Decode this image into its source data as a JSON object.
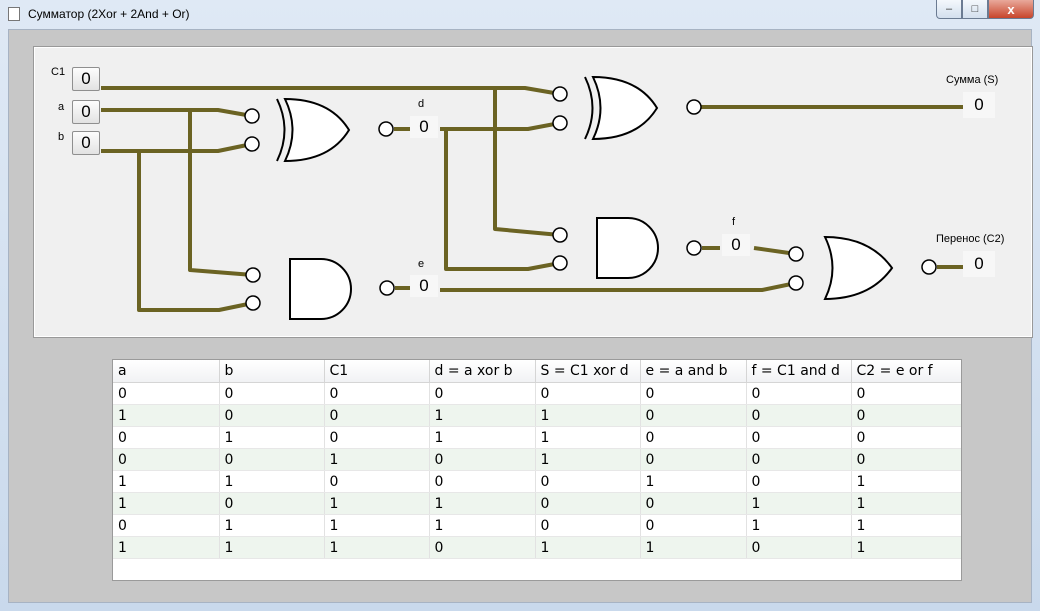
{
  "window": {
    "title": "Сумматор (2Xor + 2And + Or)",
    "controls": {
      "minimize": "–",
      "maximize": "□",
      "close": "x"
    }
  },
  "circuit": {
    "wire_color": "#6b6323",
    "inputs": [
      {
        "label": "C1",
        "value": "0"
      },
      {
        "label": "a",
        "value": "0"
      },
      {
        "label": "b",
        "value": "0"
      }
    ],
    "nodes": [
      {
        "label": "d",
        "value": "0"
      },
      {
        "label": "e",
        "value": "0"
      },
      {
        "label": "f",
        "value": "0"
      }
    ],
    "outputs": [
      {
        "label": "Сумма (S)",
        "value": "0"
      },
      {
        "label": "Перенос (C2)",
        "value": "0"
      }
    ]
  },
  "table": {
    "headers": [
      "a",
      "b",
      "C1",
      "d = a xor b",
      "S = C1 xor d",
      "e = a and b",
      "f = C1 and d",
      "C2 = e or f"
    ],
    "rows": [
      [
        "0",
        "0",
        "0",
        "0",
        "0",
        "0",
        "0",
        "0"
      ],
      [
        "1",
        "0",
        "0",
        "1",
        "1",
        "0",
        "0",
        "0"
      ],
      [
        "0",
        "1",
        "0",
        "1",
        "1",
        "0",
        "0",
        "0"
      ],
      [
        "0",
        "0",
        "1",
        "0",
        "1",
        "0",
        "0",
        "0"
      ],
      [
        "1",
        "1",
        "0",
        "0",
        "0",
        "1",
        "0",
        "1"
      ],
      [
        "1",
        "0",
        "1",
        "1",
        "0",
        "0",
        "1",
        "1"
      ],
      [
        "0",
        "1",
        "1",
        "1",
        "0",
        "0",
        "1",
        "1"
      ],
      [
        "1",
        "1",
        "1",
        "0",
        "1",
        "1",
        "0",
        "1"
      ]
    ]
  }
}
